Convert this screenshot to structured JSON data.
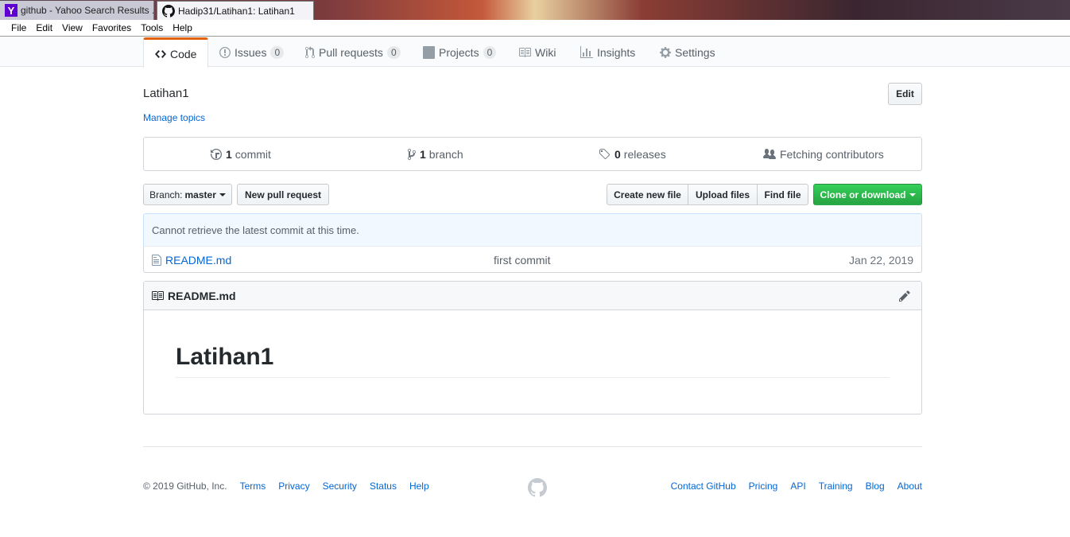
{
  "browser": {
    "tabs": [
      {
        "title": "github - Yahoo Search Results ...",
        "active": false
      },
      {
        "title": "Hadip31/Latihan1: Latihan1",
        "active": true
      }
    ],
    "menu": [
      "File",
      "Edit",
      "View",
      "Favorites",
      "Tools",
      "Help"
    ]
  },
  "reponav": {
    "code": "Code",
    "issues": "Issues",
    "issues_count": "0",
    "pulls": "Pull requests",
    "pulls_count": "0",
    "projects": "Projects",
    "projects_count": "0",
    "wiki": "Wiki",
    "insights": "Insights",
    "settings": "Settings"
  },
  "repo": {
    "description": "Latihan1",
    "manage_topics": "Manage topics",
    "edit_button": "Edit"
  },
  "summary": {
    "commits_num": "1",
    "commits_label": "commit",
    "branches_num": "1",
    "branches_label": "branch",
    "releases_num": "0",
    "releases_label": "releases",
    "contributors": "Fetching contributors"
  },
  "filenav": {
    "branch_label": "Branch:",
    "branch_name": "master",
    "new_pr": "New pull request",
    "create_file": "Create new file",
    "upload_files": "Upload files",
    "find_file": "Find file",
    "clone": "Clone or download"
  },
  "commit_tease": "Cannot retrieve the latest commit at this time.",
  "files": [
    {
      "name": "README.md",
      "message": "first commit",
      "age": "Jan 22, 2019"
    }
  ],
  "readme": {
    "filename": "README.md",
    "heading": "Latihan1"
  },
  "footer": {
    "copyright": "© 2019 GitHub, Inc.",
    "left_links": [
      "Terms",
      "Privacy",
      "Security",
      "Status",
      "Help"
    ],
    "right_links": [
      "Contact GitHub",
      "Pricing",
      "API",
      "Training",
      "Blog",
      "About"
    ]
  },
  "colors": {
    "accent_orange": "#e36209",
    "link_blue": "#0366d6",
    "clone_green": "#28a745"
  }
}
